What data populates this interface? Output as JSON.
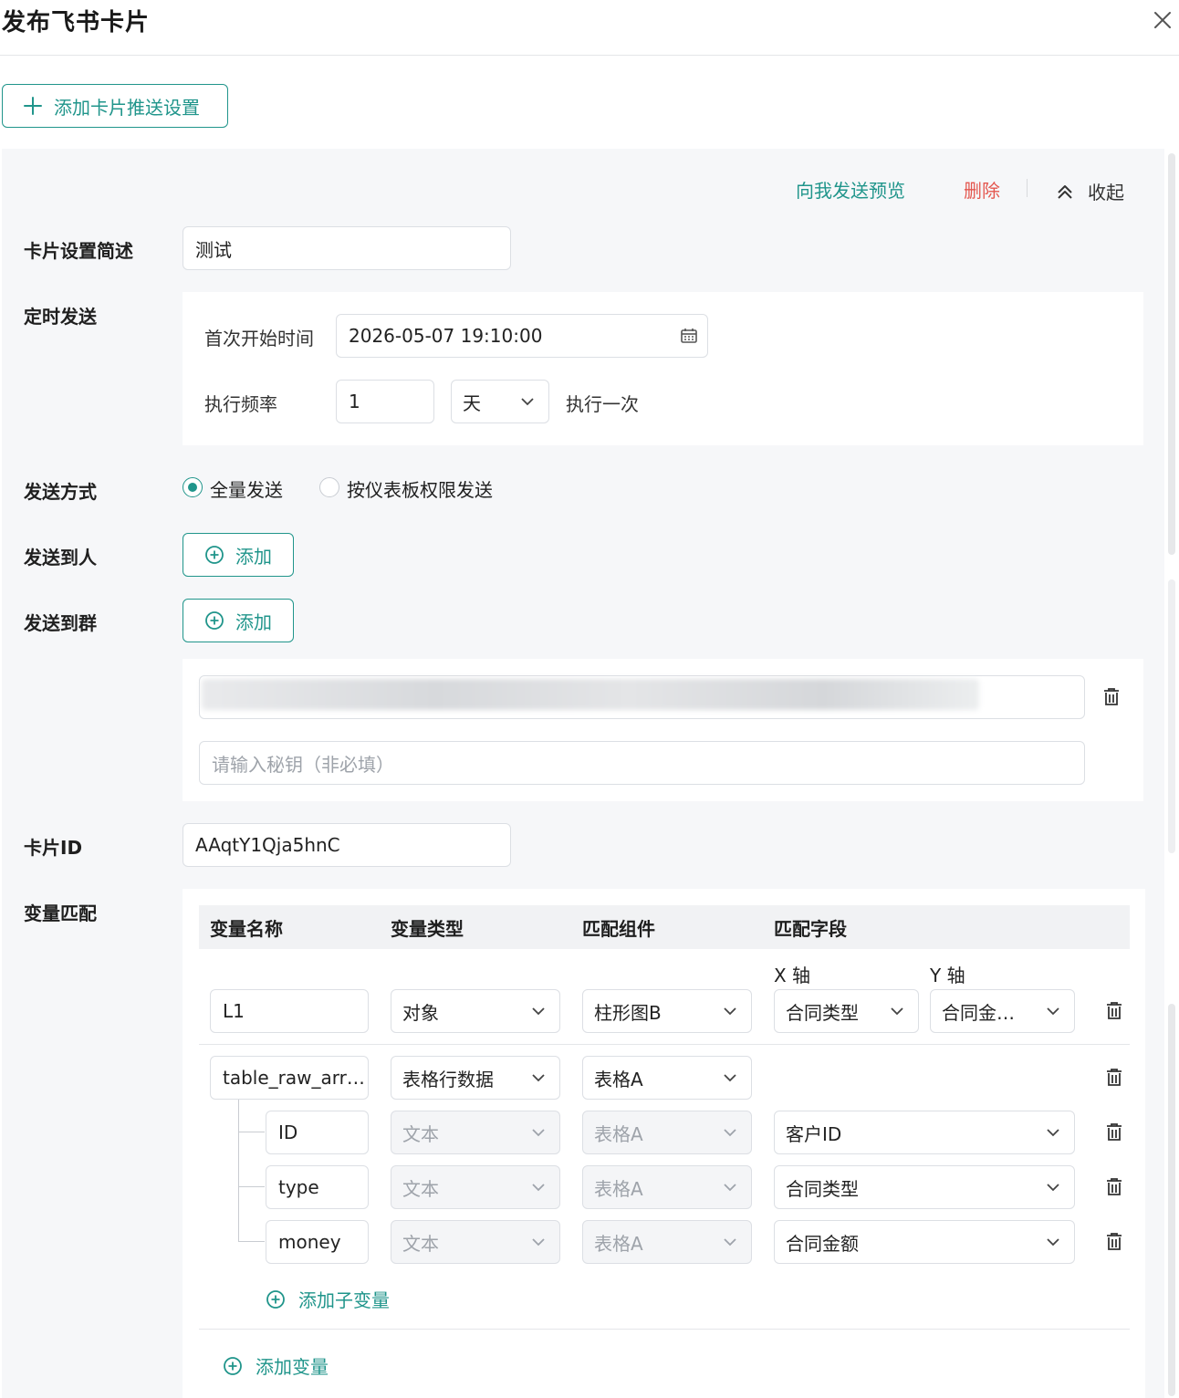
{
  "dialog": {
    "title": "发布飞书卡片"
  },
  "toolbar": {
    "add_push_label": "添加卡片推送设置"
  },
  "card": {
    "actions": {
      "preview": "向我发送预览",
      "delete": "删除",
      "collapse": "收起"
    },
    "fields": {
      "desc_label": "卡片设置简述",
      "desc_value": "测试",
      "schedule_label": "定时发送",
      "start_time_label": "首次开始时间",
      "start_time_value": "2026-05-07 19:10:00",
      "freq_label": "执行频率",
      "freq_value": "1",
      "freq_unit": "天",
      "freq_suffix": "执行一次",
      "send_mode_label": "发送方式",
      "send_mode_all": "全量发送",
      "send_mode_perm": "按仪表板权限发送",
      "send_to_person_label": "发送到人",
      "send_to_group_label": "发送到群",
      "add_label": "添加",
      "secret_placeholder": "请输入秘钥（非必填）",
      "card_id_label": "卡片ID",
      "card_id_value": "AAqtY1Qja5hnC",
      "var_match_label": "变量匹配"
    },
    "table": {
      "headers": [
        "变量名称",
        "变量类型",
        "匹配组件",
        "匹配字段"
      ],
      "x_axis": "X 轴",
      "y_axis": "Y 轴",
      "row1": {
        "name": "L1",
        "type": "对象",
        "component": "柱形图B",
        "x": "合同类型",
        "y": "合同金…"
      },
      "row2": {
        "name": "table_raw_arr…",
        "type": "表格行数据",
        "component": "表格A"
      },
      "children": [
        {
          "name": "ID",
          "type": "文本",
          "component": "表格A",
          "field": "客户ID"
        },
        {
          "name": "type",
          "type": "文本",
          "component": "表格A",
          "field": "合同类型"
        },
        {
          "name": "money",
          "type": "文本",
          "component": "表格A",
          "field": "合同金额"
        }
      ],
      "add_child": "添加子变量",
      "add_var": "添加变量"
    }
  }
}
